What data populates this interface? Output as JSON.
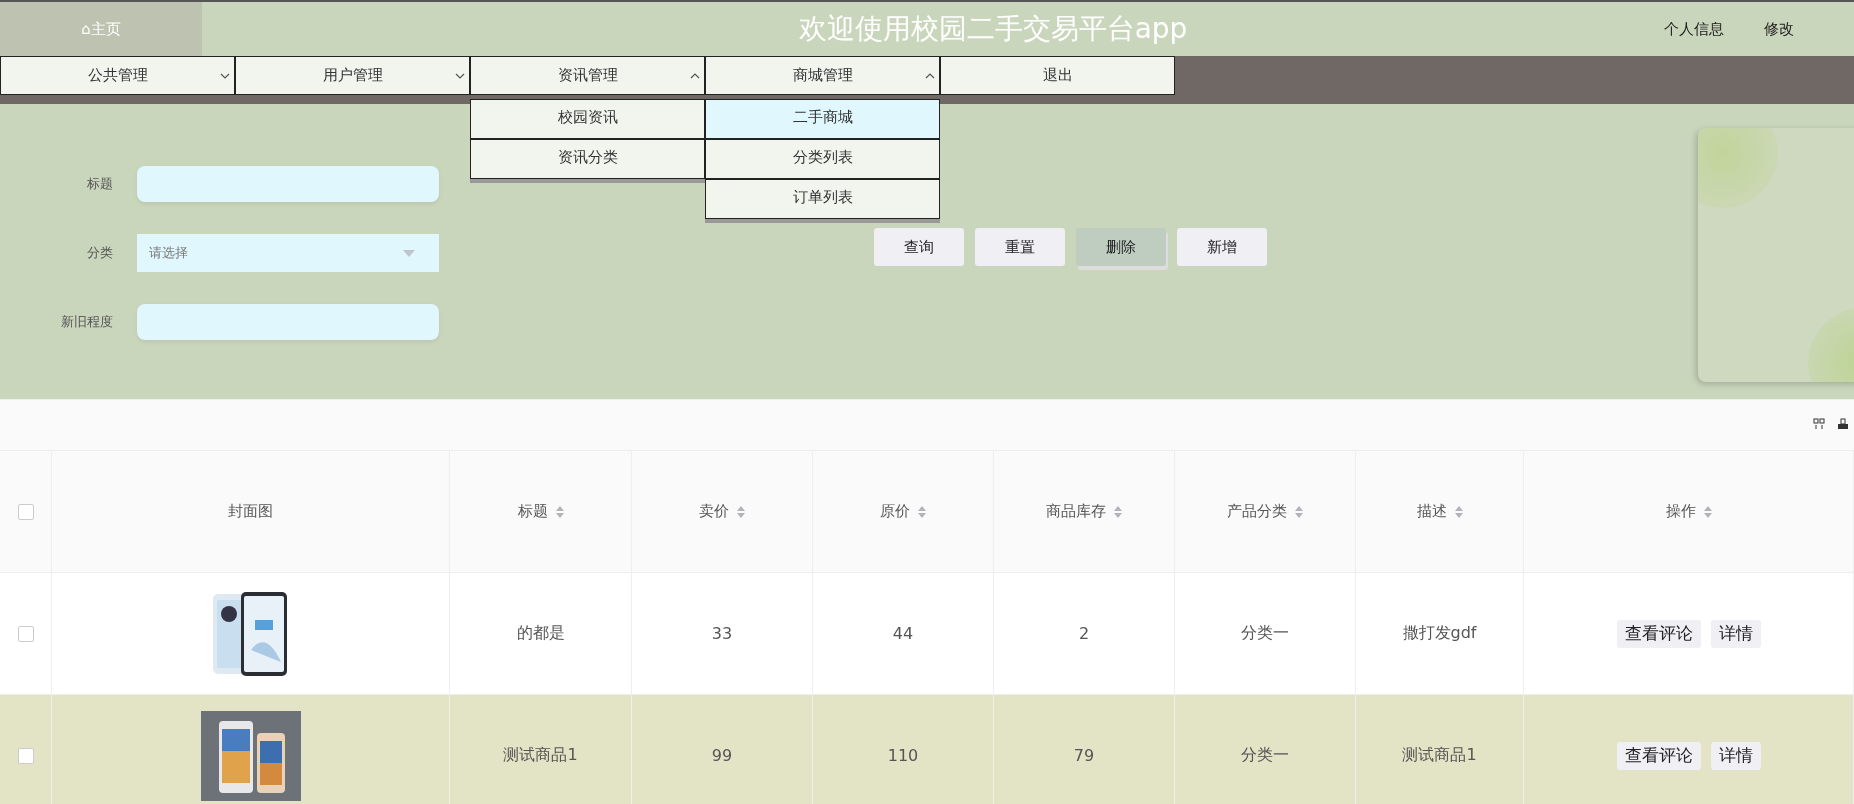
{
  "header": {
    "home": "⌂主页",
    "title": "欢迎使用校园二手交易平台app",
    "links": [
      "个人信息",
      "修改"
    ]
  },
  "nav": [
    {
      "label": "公共管理",
      "expanded": false
    },
    {
      "label": "用户管理",
      "expanded": false
    },
    {
      "label": "资讯管理",
      "expanded": true,
      "children": [
        {
          "label": "校园资讯",
          "selected": false
        },
        {
          "label": "资讯分类",
          "selected": false
        }
      ]
    },
    {
      "label": "商城管理",
      "expanded": true,
      "children": [
        {
          "label": "二手商城",
          "selected": true
        },
        {
          "label": "分类列表",
          "selected": false
        },
        {
          "label": "订单列表",
          "selected": false
        }
      ]
    },
    {
      "label": "退出"
    }
  ],
  "search": {
    "fields": [
      {
        "label": "标题",
        "kind": "text"
      },
      {
        "label": "分类",
        "kind": "select",
        "placeholder": "请选择"
      },
      {
        "label": "新旧程度",
        "kind": "text"
      }
    ],
    "buttons": [
      {
        "label": "查询",
        "hovered": false
      },
      {
        "label": "重置",
        "hovered": false
      },
      {
        "label": "删除",
        "hovered": true
      },
      {
        "label": "新增",
        "hovered": false
      }
    ]
  },
  "table": {
    "columns": [
      {
        "kind": "checkbox",
        "checked": false
      },
      {
        "kind": "text",
        "label": "封面图",
        "sortable": false
      },
      {
        "kind": "text",
        "label": "标题",
        "sortable": true
      },
      {
        "kind": "text",
        "label": "卖价",
        "sortable": true
      },
      {
        "kind": "text",
        "label": "原价",
        "sortable": true
      },
      {
        "kind": "text",
        "label": "商品库存",
        "sortable": true
      },
      {
        "kind": "text",
        "label": "产品分类",
        "sortable": true
      },
      {
        "kind": "text",
        "label": "描述",
        "sortable": true
      },
      {
        "kind": "text",
        "label": "操作",
        "sortable": true
      }
    ],
    "rows": [
      {
        "hovered": false,
        "cells": [
          {
            "kind": "checkbox",
            "checked": false
          },
          {
            "kind": "picture"
          },
          {
            "kind": "text",
            "text": "的都是"
          },
          {
            "kind": "text",
            "text": "33"
          },
          {
            "kind": "text",
            "text": "44"
          },
          {
            "kind": "text",
            "text": "2"
          },
          {
            "kind": "text",
            "text": "分类一"
          },
          {
            "kind": "text",
            "text": "撒打发gdf"
          },
          {
            "kind": "actions",
            "actions": [
              "查看评论",
              "详情"
            ]
          }
        ]
      },
      {
        "hovered": true,
        "cells": [
          {
            "kind": "checkbox",
            "checked": false
          },
          {
            "kind": "picture"
          },
          {
            "kind": "text",
            "text": "测试商品1"
          },
          {
            "kind": "text",
            "text": "99"
          },
          {
            "kind": "text",
            "text": "110"
          },
          {
            "kind": "text",
            "text": "79"
          },
          {
            "kind": "text",
            "text": "分类一"
          },
          {
            "kind": "text",
            "text": "测试商品1"
          },
          {
            "kind": "actions",
            "actions": [
              "查看评论",
              "详情"
            ]
          }
        ]
      }
    ]
  }
}
